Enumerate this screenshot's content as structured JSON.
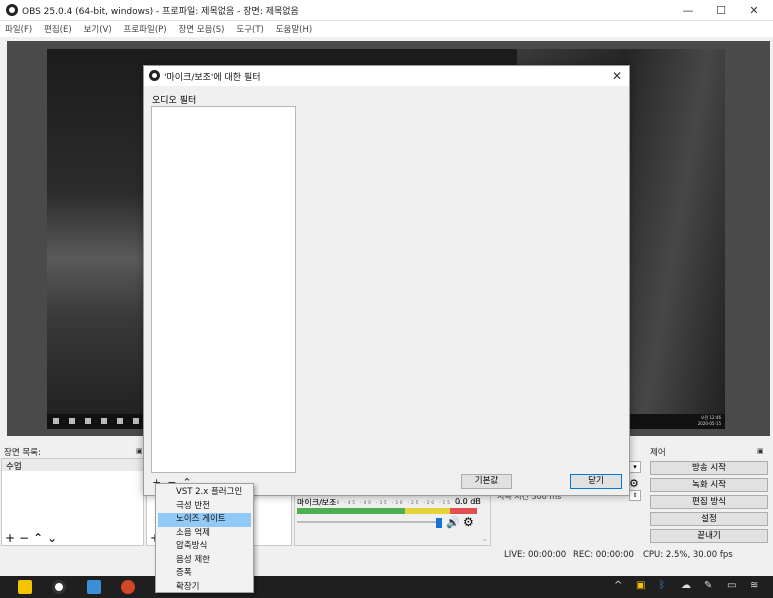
{
  "window": {
    "title": "OBS 25.0.4 (64-bit, windows) - 프로파일: 제목없음 - 장면: 제목없음"
  },
  "menu": [
    "파일(F)",
    "편집(E)",
    "보기(V)",
    "프로파일(P)",
    "장면 모음(S)",
    "도구(T)",
    "도움말(H)"
  ],
  "preview": {
    "clock_time": "오전 12:46",
    "clock_date": "2020-05-15"
  },
  "scenes": {
    "title": "장면 목록:",
    "items": [
      "수업"
    ]
  },
  "mixer": {
    "source_name": "마이크/보조",
    "level": "0.0 dB",
    "ticks": "-60 -55 -50 -45 -40 -35 -30 -25 -20 -15 -10 -5 0"
  },
  "transition": {
    "duration": "시속 시간 300 ms"
  },
  "controls": {
    "title": "제어",
    "buttons": [
      "방송 시작",
      "녹화 시작",
      "편집 방식",
      "설정",
      "끝내기"
    ]
  },
  "status": {
    "live": "LIVE: 00:00:00",
    "rec": "REC: 00:00:00",
    "cpu": "CPU: 2.5%, 30.00 fps"
  },
  "dialog": {
    "title": "'마이크/보조'에 대한 필터",
    "section_label": "오디오 필터",
    "default_button": "기본값",
    "close_button": "닫기"
  },
  "context_menu": {
    "items": [
      "VST 2.x 플러그인",
      "극성 반전",
      "노이즈 게이트",
      "소음 억제",
      "압축방식",
      "음성 제한",
      "증폭",
      "확장기"
    ],
    "highlighted_index": 2
  }
}
